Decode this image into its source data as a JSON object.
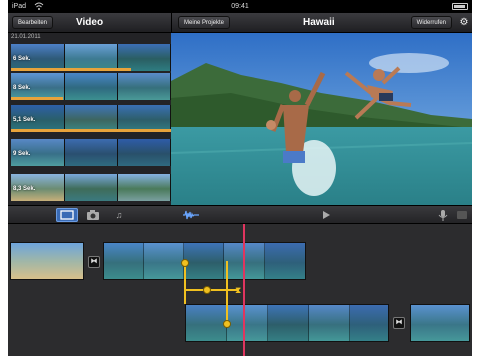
{
  "statusbar": {
    "carrier": "iPad",
    "time": "09:41"
  },
  "left_toolbar": {
    "edit_label": "Bearbeiten",
    "title": "Video"
  },
  "right_toolbar": {
    "projects_label": "Meine Projekte",
    "title": "Hawaii",
    "undo_label": "Widerrufen"
  },
  "browser": {
    "date": "21.01.2011",
    "clips": [
      {
        "duration": "6 Sek."
      },
      {
        "duration": "8 Sek."
      },
      {
        "duration": "5,1 Sek."
      },
      {
        "duration": "9 Sek."
      },
      {
        "duration": "8,3 Sek."
      }
    ]
  },
  "media_bar": {
    "tabs": [
      "video-tab",
      "photo-tab",
      "music-tab"
    ],
    "active_tab": "video-tab"
  },
  "colors": {
    "accent": "#3a6bb5",
    "playhead": "#e0355f",
    "audio_track": "#f0c020",
    "used_marker": "#e8a33b"
  }
}
